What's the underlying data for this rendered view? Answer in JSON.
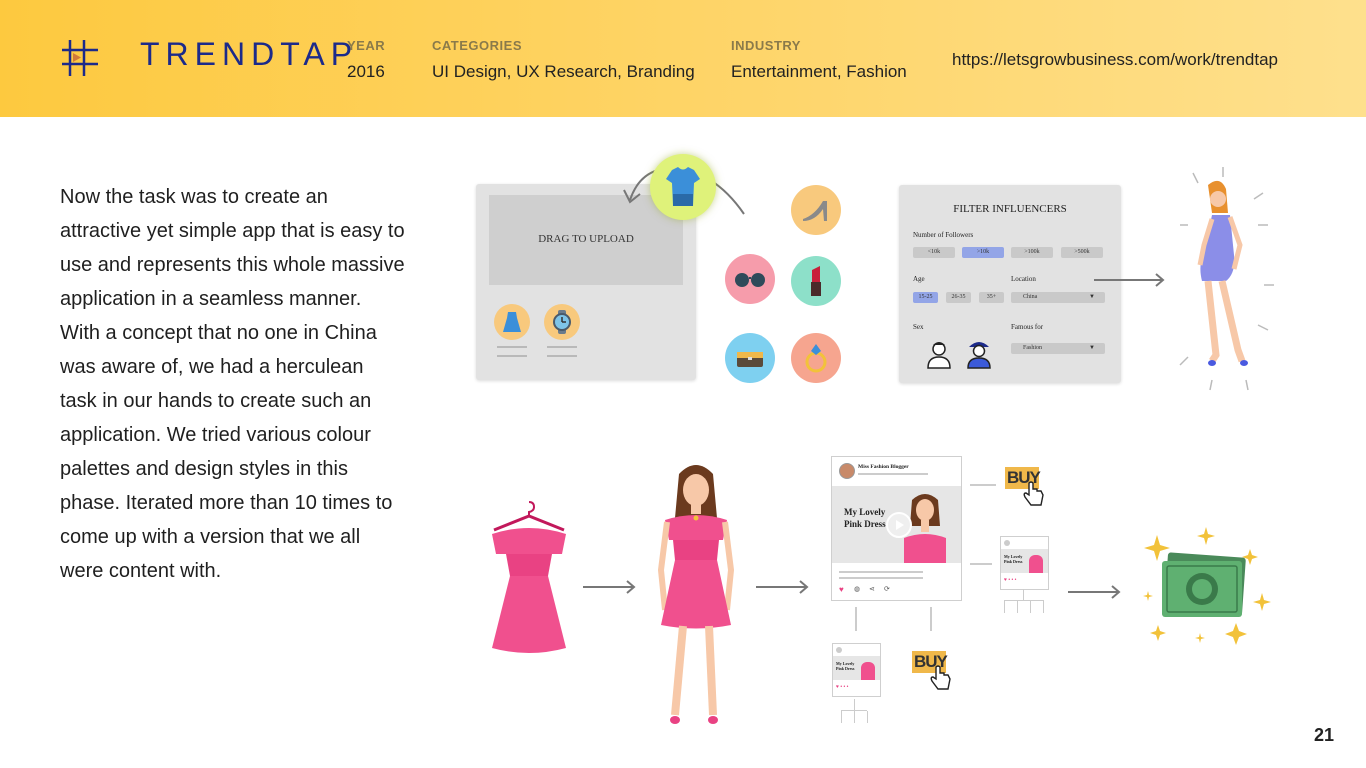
{
  "brand": {
    "name": "TRENDTAP",
    "logo_icon": "trendtap-grid-play-icon"
  },
  "meta": [
    {
      "label": "YEAR",
      "value": "2016"
    },
    {
      "label": "CATEGORIES",
      "value": "UI Design, UX Research, Branding"
    },
    {
      "label": "INDUSTRY",
      "value": "Entertainment, Fashion"
    }
  ],
  "url": "https://letsgrowbusiness.com/work/trendtap",
  "body_text": "Now the task was to create an attractive yet simple app that is easy to use and represents this whole massive application in a seamless manner. With a concept that no one in China was aware of, we had a herculean task in our hands to create such an application. We tried various colour palettes and design styles in this phase. Iterated more than 10 times to come up with a version that we all were content with.",
  "page_number": "21",
  "upload": {
    "label": "DRAG TO UPLOAD"
  },
  "filter": {
    "title": "FILTER INFLUENCERS",
    "followers_label": "Number of Followers",
    "followers": [
      "<10k",
      ">10k",
      ">100k",
      ">500k"
    ],
    "followers_active": ">10k",
    "age_label": "Age",
    "ages": [
      "15-25",
      "26-35",
      "35+"
    ],
    "age_active": "15-25",
    "location_label": "Location",
    "location_value": "China",
    "sex_label": "Sex",
    "famous_label": "Famous for",
    "famous_value": "Fashion"
  },
  "post": {
    "author": "Miss Fashion Blogger",
    "headline_line1": "My Lovely",
    "headline_line2": "Pink Dress"
  },
  "mini_post": {
    "headline_line1": "My Lovely",
    "headline_line2": "Pink Dress"
  },
  "buy_label": "BUY",
  "colors": {
    "header": "#fdc93f",
    "brand": "#1c2a8a",
    "accent_blue": "#93a5e7",
    "dress_pink": "#f0508e"
  }
}
